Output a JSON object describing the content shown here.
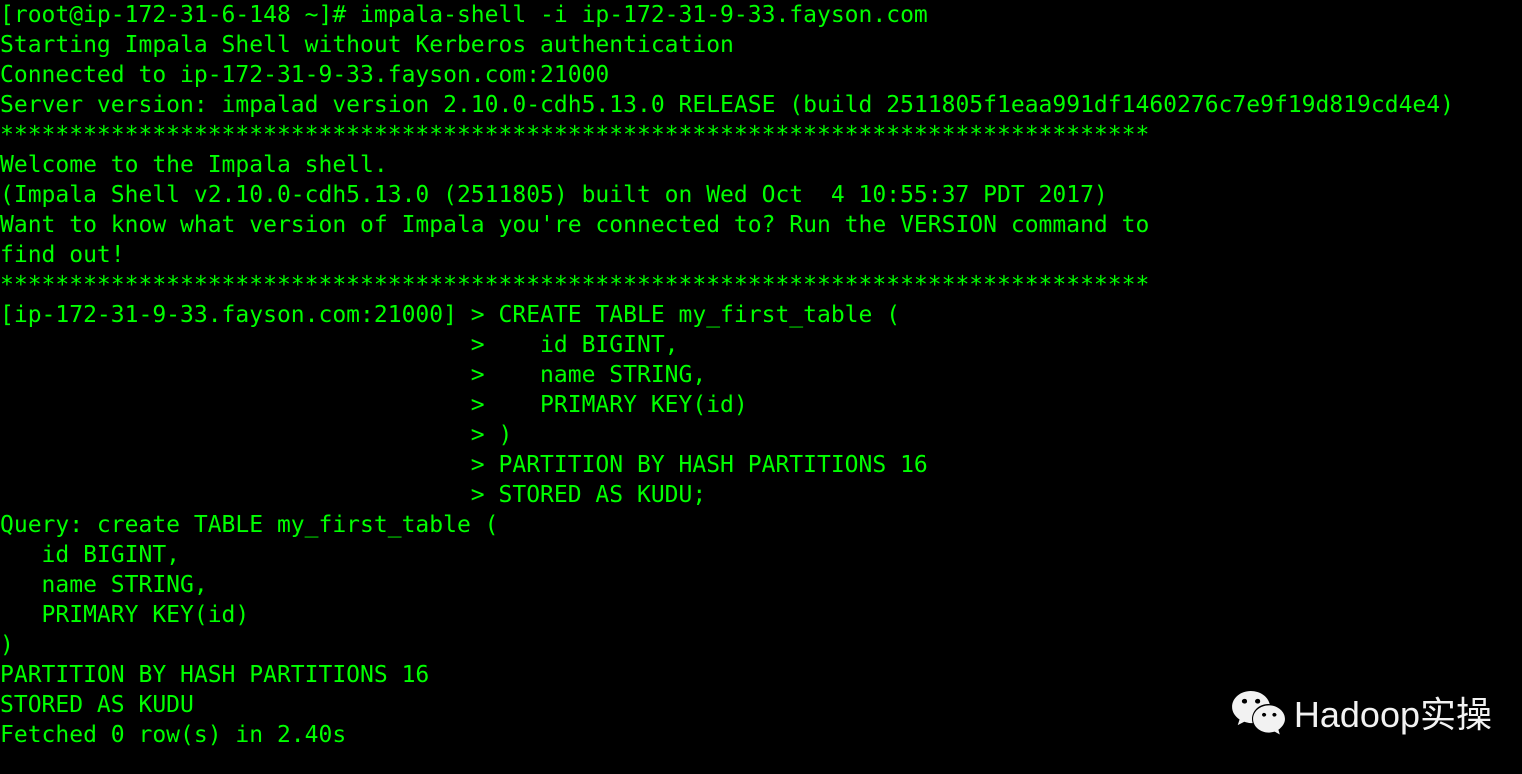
{
  "terminal": {
    "lines": [
      "[root@ip-172-31-6-148 ~]# impala-shell -i ip-172-31-9-33.fayson.com",
      "Starting Impala Shell without Kerberos authentication",
      "Connected to ip-172-31-9-33.fayson.com:21000",
      "Server version: impalad version 2.10.0-cdh5.13.0 RELEASE (build 2511805f1eaa991df1460276c7e9f19d819cd4e4)",
      "***********************************************************************************",
      "Welcome to the Impala shell.",
      "(Impala Shell v2.10.0-cdh5.13.0 (2511805) built on Wed Oct  4 10:55:37 PDT 2017)",
      "",
      "Want to know what version of Impala you're connected to? Run the VERSION command to",
      "find out!",
      "***********************************************************************************",
      "[ip-172-31-9-33.fayson.com:21000] > CREATE TABLE my_first_table (",
      "                                  >    id BIGINT,",
      "                                  >    name STRING,",
      "                                  >    PRIMARY KEY(id)",
      "                                  > )",
      "                                  > PARTITION BY HASH PARTITIONS 16",
      "                                  > STORED AS KUDU;",
      "Query: create TABLE my_first_table (",
      "   id BIGINT,",
      "   name STRING,",
      "   PRIMARY KEY(id)",
      ")",
      "PARTITION BY HASH PARTITIONS 16",
      "STORED AS KUDU",
      "Fetched 0 row(s) in 2.40s"
    ]
  },
  "watermark": {
    "text": "Hadoop实操"
  }
}
